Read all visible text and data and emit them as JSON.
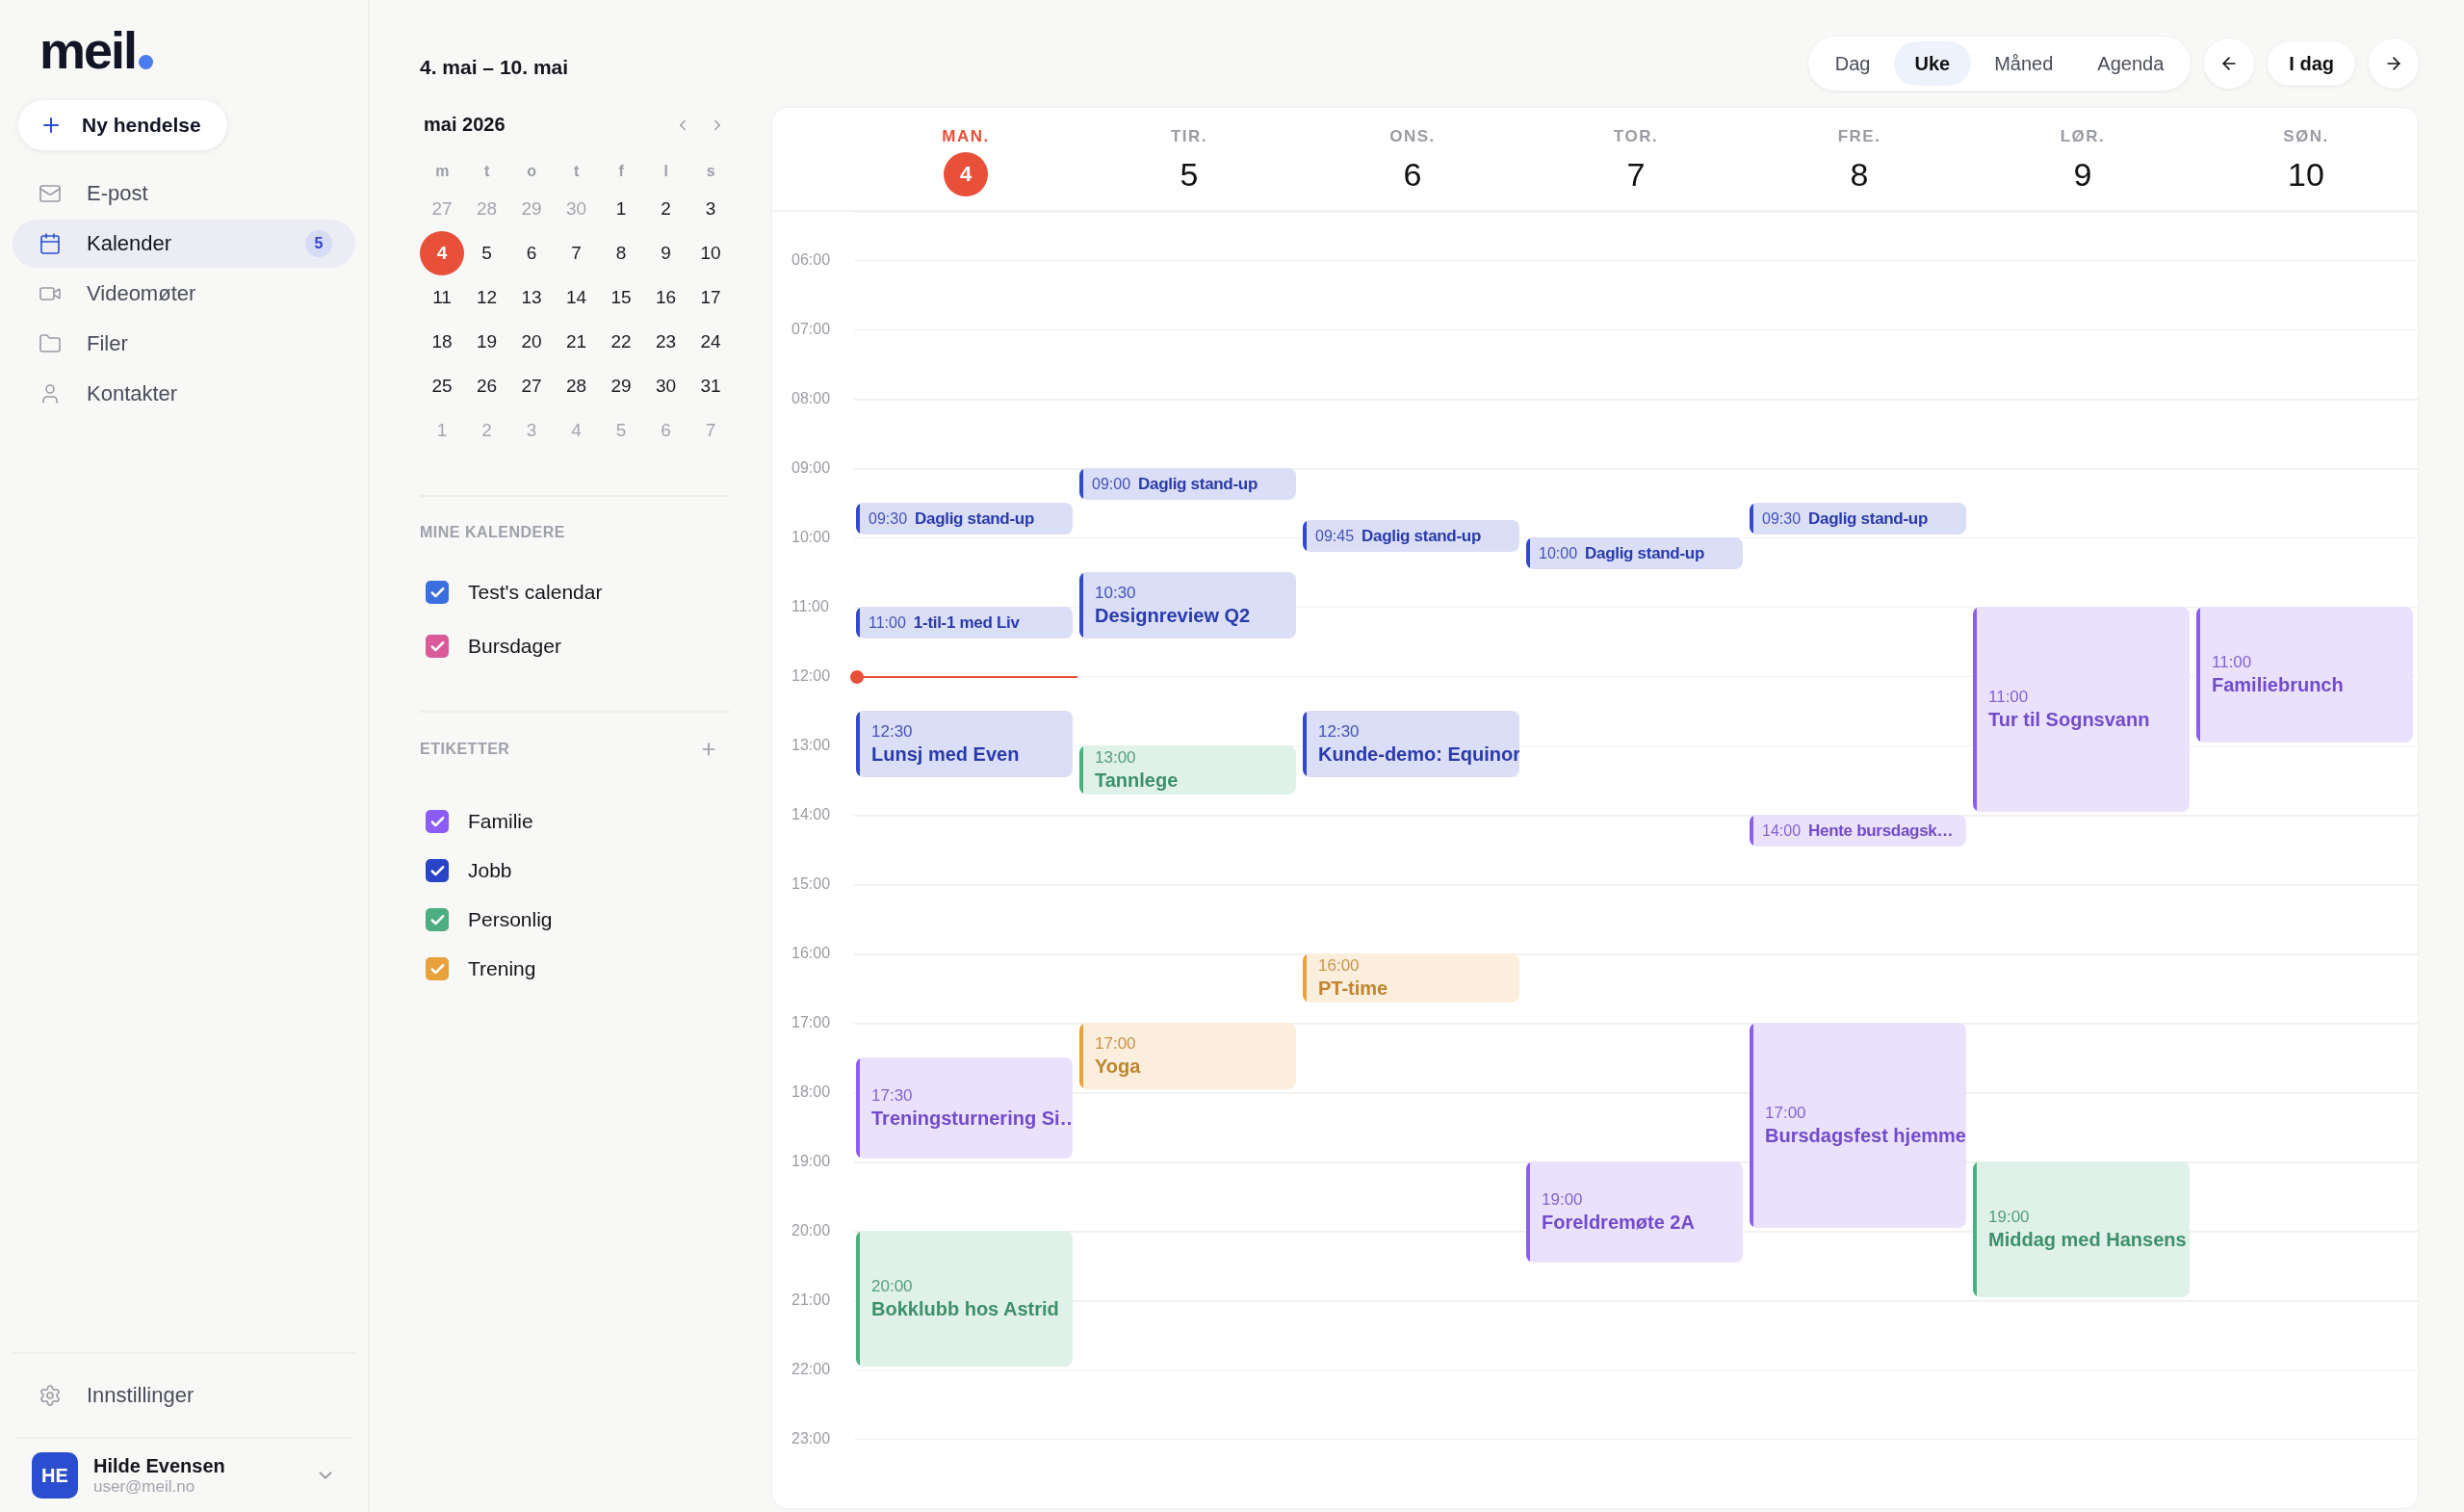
{
  "logo": {
    "text": "meil"
  },
  "new_event_button": {
    "label": "Ny hendelse"
  },
  "nav": [
    {
      "label": "E-post",
      "selected": false
    },
    {
      "label": "Kalender",
      "selected": true,
      "badge": "5"
    },
    {
      "label": "Videomøter",
      "selected": false
    },
    {
      "label": "Filer",
      "selected": false
    },
    {
      "label": "Kontakter",
      "selected": false
    }
  ],
  "settings": {
    "label": "Innstillinger"
  },
  "user": {
    "initials": "HE",
    "name": "Hilde Evensen",
    "email": "user@meil.no"
  },
  "range_title": "4. mai – 10. mai",
  "mini_calendar": {
    "title": "mai 2026",
    "weekdays": [
      "m",
      "t",
      "o",
      "t",
      "f",
      "l",
      "s"
    ],
    "weeks": [
      [
        {
          "d": "27",
          "muted": true,
          "selected": false
        },
        {
          "d": "28",
          "muted": true,
          "selected": false
        },
        {
          "d": "29",
          "muted": true,
          "selected": false
        },
        {
          "d": "30",
          "muted": true,
          "selected": false
        },
        {
          "d": "1",
          "muted": false,
          "selected": false
        },
        {
          "d": "2",
          "muted": false,
          "selected": false
        },
        {
          "d": "3",
          "muted": false,
          "selected": false
        }
      ],
      [
        {
          "d": "4",
          "muted": false,
          "selected": true
        },
        {
          "d": "5",
          "muted": false,
          "selected": false
        },
        {
          "d": "6",
          "muted": false,
          "selected": false
        },
        {
          "d": "7",
          "muted": false,
          "selected": false
        },
        {
          "d": "8",
          "muted": false,
          "selected": false
        },
        {
          "d": "9",
          "muted": false,
          "selected": false
        },
        {
          "d": "10",
          "muted": false,
          "selected": false
        }
      ],
      [
        {
          "d": "11",
          "muted": false,
          "selected": false
        },
        {
          "d": "12",
          "muted": false,
          "selected": false
        },
        {
          "d": "13",
          "muted": false,
          "selected": false
        },
        {
          "d": "14",
          "muted": false,
          "selected": false
        },
        {
          "d": "15",
          "muted": false,
          "selected": false
        },
        {
          "d": "16",
          "muted": false,
          "selected": false
        },
        {
          "d": "17",
          "muted": false,
          "selected": false
        }
      ],
      [
        {
          "d": "18",
          "muted": false,
          "selected": false
        },
        {
          "d": "19",
          "muted": false,
          "selected": false
        },
        {
          "d": "20",
          "muted": false,
          "selected": false
        },
        {
          "d": "21",
          "muted": false,
          "selected": false
        },
        {
          "d": "22",
          "muted": false,
          "selected": false
        },
        {
          "d": "23",
          "muted": false,
          "selected": false
        },
        {
          "d": "24",
          "muted": false,
          "selected": false
        }
      ],
      [
        {
          "d": "25",
          "muted": false,
          "selected": false
        },
        {
          "d": "26",
          "muted": false,
          "selected": false
        },
        {
          "d": "27",
          "muted": false,
          "selected": false
        },
        {
          "d": "28",
          "muted": false,
          "selected": false
        },
        {
          "d": "29",
          "muted": false,
          "selected": false
        },
        {
          "d": "30",
          "muted": false,
          "selected": false
        },
        {
          "d": "31",
          "muted": false,
          "selected": false
        }
      ],
      [
        {
          "d": "1",
          "muted": true,
          "selected": false
        },
        {
          "d": "2",
          "muted": true,
          "selected": false
        },
        {
          "d": "3",
          "muted": true,
          "selected": false
        },
        {
          "d": "4",
          "muted": true,
          "selected": false
        },
        {
          "d": "5",
          "muted": true,
          "selected": false
        },
        {
          "d": "6",
          "muted": true,
          "selected": false
        },
        {
          "d": "7",
          "muted": true,
          "selected": false
        }
      ]
    ]
  },
  "my_calendars": {
    "heading": "MINE KALENDERE",
    "items": [
      {
        "label": "Test's calendar",
        "checked": true,
        "color": "#3b6fe0"
      },
      {
        "label": "Bursdager",
        "checked": true,
        "color": "#db5a9a"
      }
    ]
  },
  "tags": {
    "heading": "ETIKETTER",
    "items": [
      {
        "label": "Familie",
        "checked": true,
        "color": "#8b5cf6"
      },
      {
        "label": "Jobb",
        "checked": true,
        "color": "#2a44c8"
      },
      {
        "label": "Personlig",
        "checked": true,
        "color": "#4caf82"
      },
      {
        "label": "Trening",
        "checked": true,
        "color": "#e9a23b"
      }
    ]
  },
  "view_tabs": [
    {
      "label": "Dag",
      "selected": false
    },
    {
      "label": "Uke",
      "selected": true
    },
    {
      "label": "Måned",
      "selected": false
    },
    {
      "label": "Agenda",
      "selected": false
    }
  ],
  "today_button": {
    "label": "I dag"
  },
  "hours": [
    {
      "label": "06:00",
      "now": false
    },
    {
      "label": "07:00",
      "now": false
    },
    {
      "label": "08:00",
      "now": false
    },
    {
      "label": "09:00",
      "now": false
    },
    {
      "label": "10:00",
      "now": false
    },
    {
      "label": "11:00",
      "now": false
    },
    {
      "label": "12:00",
      "now": true
    },
    {
      "label": "13:00",
      "now": false
    },
    {
      "label": "14:00",
      "now": false
    },
    {
      "label": "15:00",
      "now": false
    },
    {
      "label": "16:00",
      "now": false
    },
    {
      "label": "17:00",
      "now": false
    },
    {
      "label": "18:00",
      "now": false
    },
    {
      "label": "19:00",
      "now": false
    },
    {
      "label": "20:00",
      "now": false
    },
    {
      "label": "21:00",
      "now": false
    },
    {
      "label": "22:00",
      "now": false
    },
    {
      "label": "23:00",
      "now": false
    }
  ],
  "days": [
    {
      "weekday": "MAN.",
      "date": "4",
      "today": true,
      "now": true,
      "events": [
        {
          "time": "09:30",
          "kind": "half",
          "title": "Daglig stand-up",
          "color": "#3347d1"
        },
        {
          "time": "11:00",
          "kind": "half",
          "title": "1-til-1 med Liv",
          "color": "#3347d1"
        },
        {
          "time": "12:30",
          "kind": "hour",
          "title": "Lunsj med Even",
          "color": "#3347d1"
        },
        {
          "time": "17:30",
          "kind": "hourhalf",
          "title": "Treningsturnering Si…",
          "color": "#8b5cf6"
        },
        {
          "time": "20:00",
          "kind": "twohours",
          "title": "Bokklubb hos Astrid",
          "color": "#4caf82"
        }
      ]
    },
    {
      "weekday": "TIR.",
      "date": "5",
      "today": false,
      "now": false,
      "events": [
        {
          "time": "09:00",
          "kind": "half",
          "title": "Daglig stand-up",
          "color": "#3347d1"
        },
        {
          "time": "10:30",
          "kind": "hour",
          "title": "Designreview Q2",
          "color": "#3347d1"
        },
        {
          "time": "13:00",
          "kind": "threequarters",
          "title": "Tannlege",
          "color": "#4caf82"
        },
        {
          "time": "17:00",
          "kind": "hour",
          "title": "Yoga",
          "color": "#e9a23b"
        }
      ]
    },
    {
      "weekday": "ONS.",
      "date": "6",
      "today": false,
      "now": false,
      "events": [
        {
          "time": "09:45",
          "kind": "half",
          "title": "Daglig stand-up",
          "color": "#3347d1"
        },
        {
          "time": "12:30",
          "kind": "hour",
          "title": "Kunde-demo: Equinor",
          "color": "#3347d1"
        },
        {
          "time": "16:00",
          "kind": "threequarters",
          "title": "PT-time",
          "color": "#e9a23b"
        }
      ]
    },
    {
      "weekday": "TOR.",
      "date": "7",
      "today": false,
      "now": false,
      "events": [
        {
          "time": "10:00",
          "kind": "half",
          "title": "Daglig stand-up",
          "color": "#3347d1"
        },
        {
          "time": "19:00",
          "kind": "hourhalf",
          "title": "Foreldremøte 2A",
          "color": "#8b5cf6"
        }
      ]
    },
    {
      "weekday": "FRE.",
      "date": "8",
      "today": false,
      "now": false,
      "events": [
        {
          "time": "09:30",
          "kind": "half",
          "title": "Daglig stand-up",
          "color": "#3347d1"
        },
        {
          "time": "14:00",
          "kind": "half",
          "title": "Hente bursdagsk…",
          "color": "#8b5cf6"
        },
        {
          "time": "17:00",
          "kind": "threehours",
          "title": "Bursdagsfest hjemme",
          "color": "#8b5cf6"
        }
      ]
    },
    {
      "weekday": "LØR.",
      "date": "9",
      "today": false,
      "now": false,
      "events": [
        {
          "time": "11:00",
          "kind": "threehours",
          "title": "Tur til Sognsvann",
          "color": "#8b5cf6"
        },
        {
          "time": "19:00",
          "kind": "twohours",
          "title": "Middag med Hansens",
          "color": "#4caf82"
        }
      ]
    },
    {
      "weekday": "SØN.",
      "date": "10",
      "today": false,
      "now": false,
      "events": [
        {
          "time": "11:00",
          "kind": "twohours",
          "title": "Familiebrunch",
          "color": "#8b5cf6"
        }
      ]
    }
  ]
}
